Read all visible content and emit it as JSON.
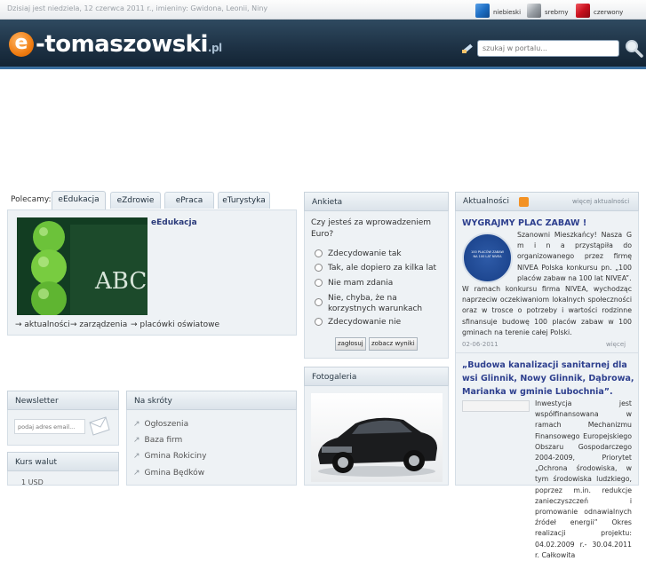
{
  "topbar": {
    "date_text": "Dzisiaj jest niedziela, 12 czerwca 2011 r., imieniny: Gwidona, Leonii, Niny",
    "themes": [
      {
        "label": "niebieski",
        "color": "#1e6fc4"
      },
      {
        "label": "srebrny",
        "color": "#9aa0a6"
      },
      {
        "label": "czerwony",
        "color": "#c8101e"
      }
    ]
  },
  "header": {
    "logo_letter": "e",
    "logo_name": "-tomaszowski",
    "logo_tld": ".pl",
    "search_placeholder": "szukaj w portalu..."
  },
  "recommend": {
    "label": "Polecamy:",
    "tabs": [
      "eEdukacja",
      "eZdrowie",
      "ePraca",
      "eTurystyka"
    ],
    "feature_title": "eEdukacja",
    "image_text": "ABC",
    "links": [
      "aktualności",
      "zarządzenia",
      "placówki oświatowe"
    ]
  },
  "poll": {
    "header": "Ankieta",
    "question": "Czy jesteś za wprowadzeniem Euro?",
    "options": [
      "Zdecydowanie tak",
      "Tak, ale dopiero za kilka lat",
      "Nie mam zdania",
      "Nie, chyba, że na korzystnych warunkach",
      "Zdecydowanie nie"
    ],
    "vote_label": "zagłosuj",
    "results_label": "zobacz wyniki"
  },
  "gallery": {
    "header": "Fotogaleria"
  },
  "news": {
    "header": "Aktualności",
    "more_label": "więcej aktualności",
    "item1": {
      "title": "WYGRAJMY PLAC ZABAW !",
      "logo_text": "100 PLACÓW ZABAW NA 100 LAT NIVEA",
      "body_side": "Szanowni Mieszkańcy! Nasza G m i n a przystąpiła do organizowanego przez firmę NIVEA Polska konkursu pn. „100 placów zabaw na 100 lat NIVEA”.",
      "body_full": "W ramach konkursu firma NIVEA, wychodząc naprzeciw oczekiwaniom lokalnych społeczności oraz w trosce o potrzeby i wartości rodzinne sfinansuje budowę 100 placów zabaw w 100 gminach na terenie całej Polski.",
      "date": "02-06-2011",
      "more": "więcej"
    },
    "item2": {
      "title": "„Budowa kanalizacji sanitarnej dla wsi Glinnik, Nowy Glinnik, Dąbrowa, Marianka w gminie Lubochnia”.",
      "body_side": "Inwestycja jest współfinansowana w ramach Mechanizmu Finansowego Europejskiego Obszaru Gospodarczego 2004-2009, Priorytet „Ochrona środowiska, w tym środowiska ludzkiego, poprzez m.in. redukcje zanieczyszczeń i promowanie odnawialnych źródeł energii” Okres realizacji projektu: 04.02.2009 r.- 30.04.2011 r. Całkowita"
    }
  },
  "newsletter": {
    "header": "Newsletter",
    "placeholder": "podaj adres email..."
  },
  "currency": {
    "header": "Kurs walut",
    "partial_text": "1 USD"
  },
  "shortcuts": {
    "header": "Na skróty",
    "items": [
      "Ogłoszenia",
      "Baza firm",
      "Gmina Rokiciny",
      "Gmina Będków"
    ]
  }
}
